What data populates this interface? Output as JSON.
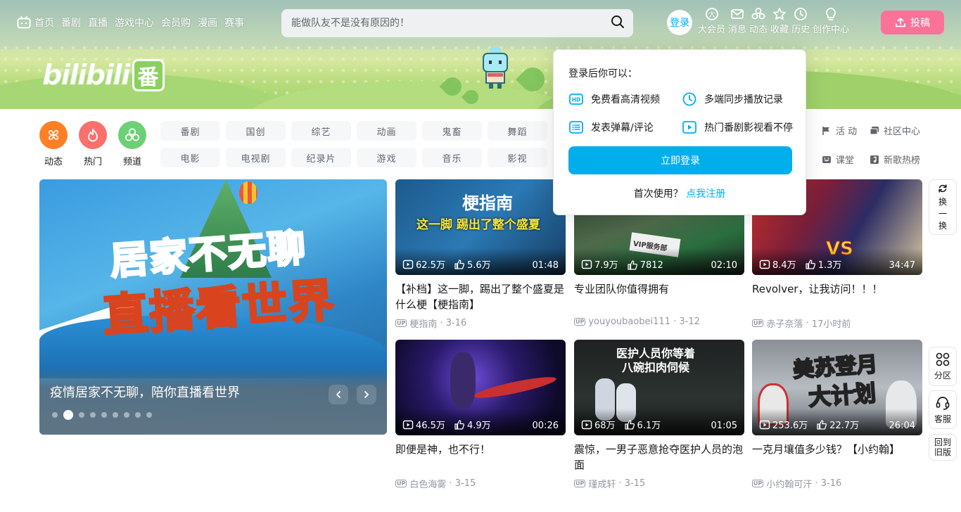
{
  "nav": {
    "home": "首页",
    "links": [
      "番剧",
      "直播",
      "游戏中心",
      "会员购",
      "漫画",
      "赛事"
    ],
    "search_placeholder": "能做队友不是没有原因的！",
    "login": "登录",
    "icons": [
      {
        "icon": "vip-icon",
        "label": "大会员"
      },
      {
        "icon": "message-icon",
        "label": "消息"
      },
      {
        "icon": "dynamic-icon",
        "label": "动态"
      },
      {
        "icon": "star-icon",
        "label": "收藏"
      },
      {
        "icon": "clock-icon",
        "label": "历史"
      },
      {
        "icon": "bulb-icon",
        "label": "创作中心"
      }
    ],
    "upload": "投稿"
  },
  "banner": {
    "logo_text": "bilibili",
    "logo_badge": "番"
  },
  "quick": [
    {
      "label": "动态",
      "color": "#ff7f24",
      "icon": "dynamic-icon"
    },
    {
      "label": "热门",
      "color": "#f9706c",
      "icon": "fire-icon"
    },
    {
      "label": "频道",
      "color": "#6dd074",
      "icon": "channel-icon"
    }
  ],
  "channels": [
    "番剧",
    "国创",
    "综艺",
    "动画",
    "鬼畜",
    "舞蹈",
    "电影",
    "电视剧",
    "纪录片",
    "游戏",
    "音乐",
    "影视"
  ],
  "side_links": {
    "col1": [
      "活 动",
      "课堂"
    ],
    "col2": [
      "社区中心",
      "新歌热榜"
    ]
  },
  "carousel": {
    "caption": "疫情居家不无聊，陪你直播看世界",
    "art_line1": "居家不无聊",
    "art_line2": "直播看世界",
    "slide_count": 9,
    "active_index": 1
  },
  "videos": [
    {
      "title": "【补档】这一脚，踢出了整个盛夏是什么梗【梗指南】",
      "views": "62.5万",
      "likes": "5.6万",
      "duration": "01:48",
      "uploader": "梗指南",
      "date": "3-16",
      "thumb_text1": "梗指南",
      "thumb_text2": "这一脚 踢出了整个盛夏"
    },
    {
      "title": "专业团队你值得拥有",
      "views": "7.9万",
      "likes": "7812",
      "duration": "02:10",
      "uploader": "youyoubaobei111",
      "date": "3-12",
      "thumb_text1": "VIP服务部",
      "thumb_text2": ""
    },
    {
      "title": "Revolver，让我访问！！！",
      "views": "8.4万",
      "likes": "1.3万",
      "duration": "34:47",
      "uploader": "赤子奈落",
      "date": "17小时前",
      "thumb_text1": "VS",
      "thumb_text2": ""
    },
    {
      "title": "即便是神，也不行！",
      "views": "46.5万",
      "likes": "4.9万",
      "duration": "00:26",
      "uploader": "白色海雾",
      "date": "3-15",
      "thumb_text1": "",
      "thumb_text2": ""
    },
    {
      "title": "震惊，一男子恶意抢夺医护人员的泡面",
      "views": "68万",
      "likes": "6.1万",
      "duration": "01:05",
      "uploader": "瑾成轩",
      "date": "3-15",
      "thumb_text1": "医护人员你等着",
      "thumb_text2": "八碗扣肉伺候"
    },
    {
      "title": "一克月壤值多少钱？【小约翰】",
      "views": "253.6万",
      "likes": "22.7万",
      "duration": "26:04",
      "uploader": "小约翰可汗",
      "date": "3-16",
      "thumb_text1": "美苏登月",
      "thumb_text2": "大计划"
    }
  ],
  "popup": {
    "title": "登录后你可以：",
    "features": [
      "免费看高清视频",
      "多端同步播放记录",
      "发表弹幕/评论",
      "热门番剧影视看不停"
    ],
    "login_button": "立即登录",
    "first_use": "首次使用？",
    "register": "点我注册"
  },
  "float": {
    "refresh": [
      "换",
      "一",
      "换"
    ],
    "partition": "分区",
    "service": "客服",
    "old_line1": "回到",
    "old_line2": "旧版"
  },
  "colors": {
    "accent": "#00aeec",
    "pink": "#fb7299"
  }
}
